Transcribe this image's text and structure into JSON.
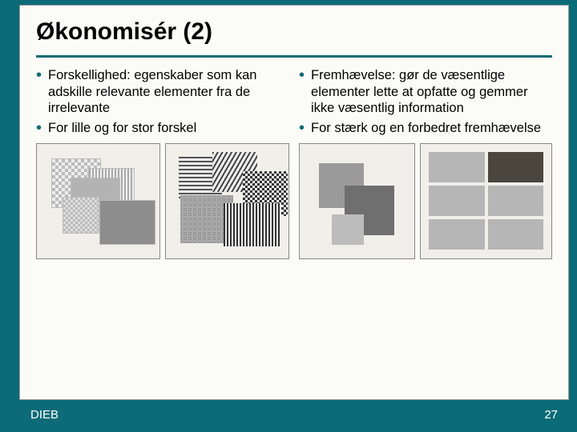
{
  "title": "Økonomisér (2)",
  "left": {
    "bullets": [
      "Forskellighed: egenskaber som kan adskille relevante elementer fra de irrelevante",
      "For lille og for stor forskel"
    ]
  },
  "right": {
    "bullets": [
      "Fremhævelse: gør de væsentlige elementer lette at opfatte og gemmer ikke væsentlig information",
      "For stærk og en forbedret fremhævelse"
    ]
  },
  "footer": {
    "label": "DIEB",
    "pagenum": "27"
  },
  "colors": {
    "accent": "#0b6b77",
    "background": "#fbfbf7"
  }
}
